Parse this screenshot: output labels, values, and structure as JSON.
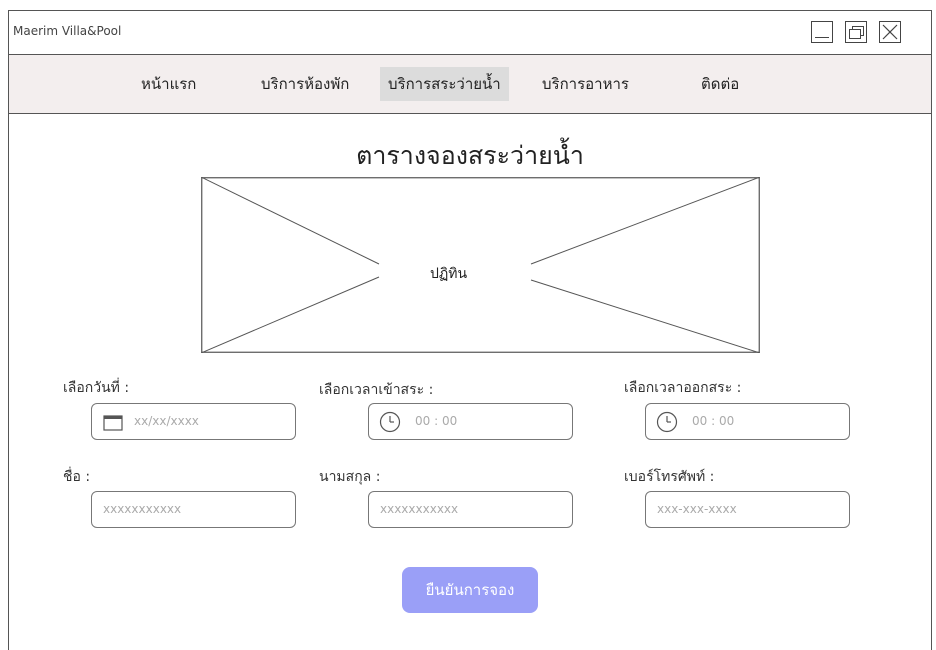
{
  "window": {
    "title": "Maerim Villa&Pool"
  },
  "nav": {
    "items": [
      {
        "label": "หน้าแรก",
        "active": false
      },
      {
        "label": "บริการห้องพัก",
        "active": false
      },
      {
        "label": "บริการสระว่ายน้ำ",
        "active": true
      },
      {
        "label": "บริการอาหาร",
        "active": false
      },
      {
        "label": "ติดต่อ",
        "active": false
      }
    ]
  },
  "main": {
    "heading": "ตารางจองสระว่ายน้ำ",
    "calendar_label": "ปฏิทิน"
  },
  "form": {
    "date_label": "เลือกวันที่ :",
    "date_placeholder": "xx/xx/xxxx",
    "checkin_label": "เลือกเวลาเข้าสระ :",
    "checkin_placeholder": "00 : 00",
    "checkout_label": "เลือกเวลาออกสระ :",
    "checkout_placeholder": "00 : 00",
    "firstname_label": "ชื่อ :",
    "firstname_placeholder": "xxxxxxxxxxx",
    "lastname_label": "นามสกุล :",
    "lastname_placeholder": "xxxxxxxxxxx",
    "phone_label": "เบอร์โทรศัพท์ :",
    "phone_placeholder": "xxx-xxx-xxxx",
    "confirm_label": "ยืนยันการจอง"
  },
  "icons": {
    "calendar": "calendar-icon",
    "clock": "clock-icon",
    "minimize": "minimize-icon",
    "maximize": "maximize-icon",
    "close": "close-icon"
  },
  "colors": {
    "nav_background": "#f3eeee",
    "active_tab": "#dcdcdc",
    "confirm_button": "#9a9ff7"
  }
}
